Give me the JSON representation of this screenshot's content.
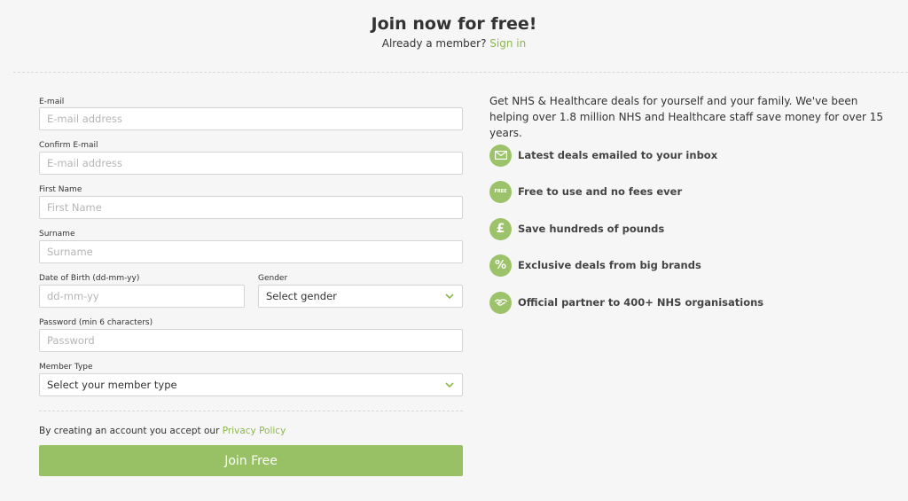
{
  "header": {
    "title": "Join now for free!",
    "member_prompt": "Already a member?",
    "sign_in": "Sign in"
  },
  "form": {
    "email": {
      "label": "E-mail",
      "placeholder": "E-mail address"
    },
    "confirm_email": {
      "label": "Confirm E-mail",
      "placeholder": "E-mail address"
    },
    "first_name": {
      "label": "First Name",
      "placeholder": "First Name"
    },
    "surname": {
      "label": "Surname",
      "placeholder": "Surname"
    },
    "dob": {
      "label": "Date of Birth (dd-mm-yy)",
      "placeholder": "dd-mm-yy"
    },
    "gender": {
      "label": "Gender",
      "value": "Select gender"
    },
    "password": {
      "label": "Password (min 6 characters)",
      "placeholder": "Password"
    },
    "member_type": {
      "label": "Member Type",
      "value": "Select your member type"
    },
    "policy_text": "By creating an account you accept our",
    "policy_link": "Privacy Policy",
    "submit": "Join Free"
  },
  "info": {
    "intro": "Get NHS & Healthcare deals for yourself and your family. We've been helping over 1.8 million NHS and Healthcare staff save money for over 15 years.",
    "features": [
      {
        "icon": "envelope-icon",
        "text": "Latest deals emailed to your inbox"
      },
      {
        "icon": "free-icon",
        "icon_text": "FREE",
        "text": "Free to use and no fees ever"
      },
      {
        "icon": "pound-icon",
        "icon_text": "£",
        "text": "Save hundreds of pounds"
      },
      {
        "icon": "percent-icon",
        "icon_text": "%",
        "text": "Exclusive deals from big brands"
      },
      {
        "icon": "handshake-icon",
        "text": "Official partner to 400+ NHS organisations"
      }
    ]
  },
  "colors": {
    "accent": "#98c064",
    "link": "#8cb84a",
    "background": "#f6f6f6"
  }
}
